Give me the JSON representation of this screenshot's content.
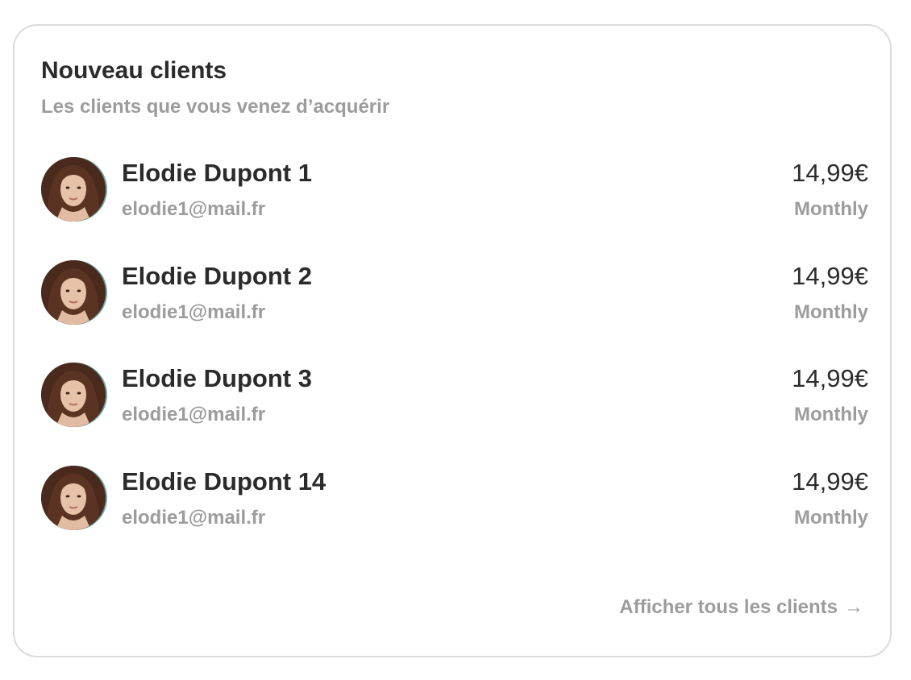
{
  "card": {
    "title": "Nouveau clients",
    "subtitle": "Les clients que vous venez d’acquérir"
  },
  "clients": [
    {
      "name": "Elodie Dupont 1",
      "email": "elodie1@mail.fr",
      "price": "14,99€",
      "period": "Monthly",
      "avatar_icon": "avatar-photo"
    },
    {
      "name": "Elodie Dupont 2",
      "email": "elodie1@mail.fr",
      "price": "14,99€",
      "period": "Monthly",
      "avatar_icon": "avatar-photo"
    },
    {
      "name": "Elodie Dupont 3",
      "email": "elodie1@mail.fr",
      "price": "14,99€",
      "period": "Monthly",
      "avatar_icon": "avatar-photo"
    },
    {
      "name": "Elodie Dupont 14",
      "email": "elodie1@mail.fr",
      "price": "14,99€",
      "period": "Monthly",
      "avatar_icon": "avatar-photo"
    }
  ],
  "footer": {
    "link_label": "Afficher tous les clients",
    "link_icon": "arrow-right-icon"
  },
  "colors": {
    "text_primary": "#2b2b2b",
    "text_secondary": "#9c9c9c",
    "card_border": "#dcdcdc"
  }
}
